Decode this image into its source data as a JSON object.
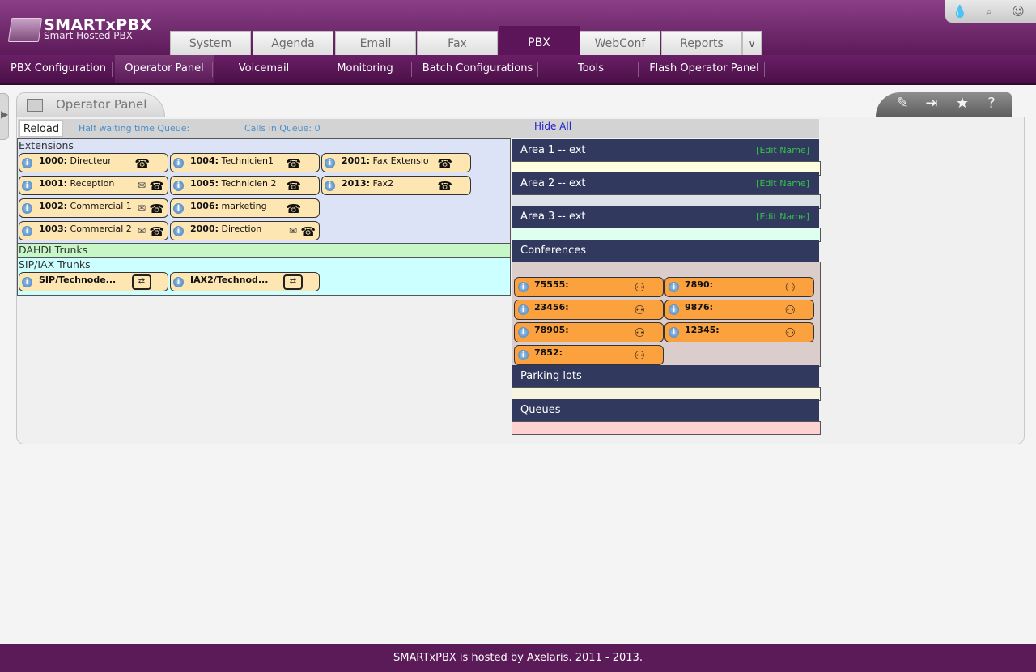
{
  "header": {
    "logo_title": "SMARTxPBX",
    "logo_subtitle": "Smart Hosted PBX",
    "icons": [
      "drop-icon",
      "search-icon",
      "user-icon"
    ]
  },
  "tabs": [
    {
      "label": "System"
    },
    {
      "label": "Agenda"
    },
    {
      "label": "Email"
    },
    {
      "label": "Fax"
    },
    {
      "label": "PBX",
      "active": true
    },
    {
      "label": "WebConf"
    },
    {
      "label": "Reports"
    }
  ],
  "subnav": [
    {
      "label": "PBX Configuration"
    },
    {
      "label": "Operator Panel",
      "selected": true
    },
    {
      "label": "Voicemail"
    },
    {
      "label": "Monitoring"
    },
    {
      "label": "Batch Configurations"
    },
    {
      "label": "Tools"
    },
    {
      "label": "Flash Operator Panel"
    }
  ],
  "panel": {
    "title": "Operator Panel",
    "tools": [
      "edit-icon",
      "split-icon",
      "star-icon",
      "help-icon"
    ]
  },
  "toolbar": {
    "reload": "Reload",
    "half_wait": "Half waiting time Queue:",
    "calls_in_queue": "Calls in Queue: 0",
    "hide_all": "Hide All"
  },
  "extensions": {
    "title": "Extensions",
    "items": [
      {
        "num": "1000:",
        "name": "Directeur",
        "mail": false
      },
      {
        "num": "1001:",
        "name": "Reception",
        "mail": true
      },
      {
        "num": "1002:",
        "name": "Commercial 1",
        "mail": true
      },
      {
        "num": "1003:",
        "name": "Commercial 2",
        "mail": true
      },
      {
        "num": "1004:",
        "name": "Technicien1",
        "mail": false
      },
      {
        "num": "1005:",
        "name": "Technicien 2",
        "mail": false
      },
      {
        "num": "1006:",
        "name": "marketing",
        "mail": false
      },
      {
        "num": "2000:",
        "name": "Direction",
        "mail": true
      },
      {
        "num": "2001:",
        "name": "Fax Extensio",
        "mail": false
      },
      {
        "num": "2013:",
        "name": "Fax2",
        "mail": false
      }
    ]
  },
  "dahdi": {
    "title": "DAHDI Trunks"
  },
  "sip": {
    "title": "SIP/IAX Trunks",
    "items": [
      {
        "name": "SIP/Technode..."
      },
      {
        "name": "IAX2/Technod..."
      }
    ]
  },
  "areas": [
    {
      "title": "Area 1 -- ext",
      "edit": "[Edit Name]",
      "color": "#ffffe0"
    },
    {
      "title": "Area 2 -- ext",
      "edit": "[Edit Name]",
      "color": "#dde3e8"
    },
    {
      "title": "Area 3 -- ext",
      "edit": "[Edit Name]",
      "color": "#dfffef"
    }
  ],
  "conferences": {
    "title": "Conferences",
    "items": [
      "75555:",
      "23456:",
      "78905:",
      "7852:",
      "7890:",
      "9876:",
      "12345:"
    ]
  },
  "parking": {
    "title": "Parking lots"
  },
  "queues": {
    "title": "Queues"
  },
  "footer": "SMARTxPBX is hosted by Axelaris. 2011 - 2013."
}
